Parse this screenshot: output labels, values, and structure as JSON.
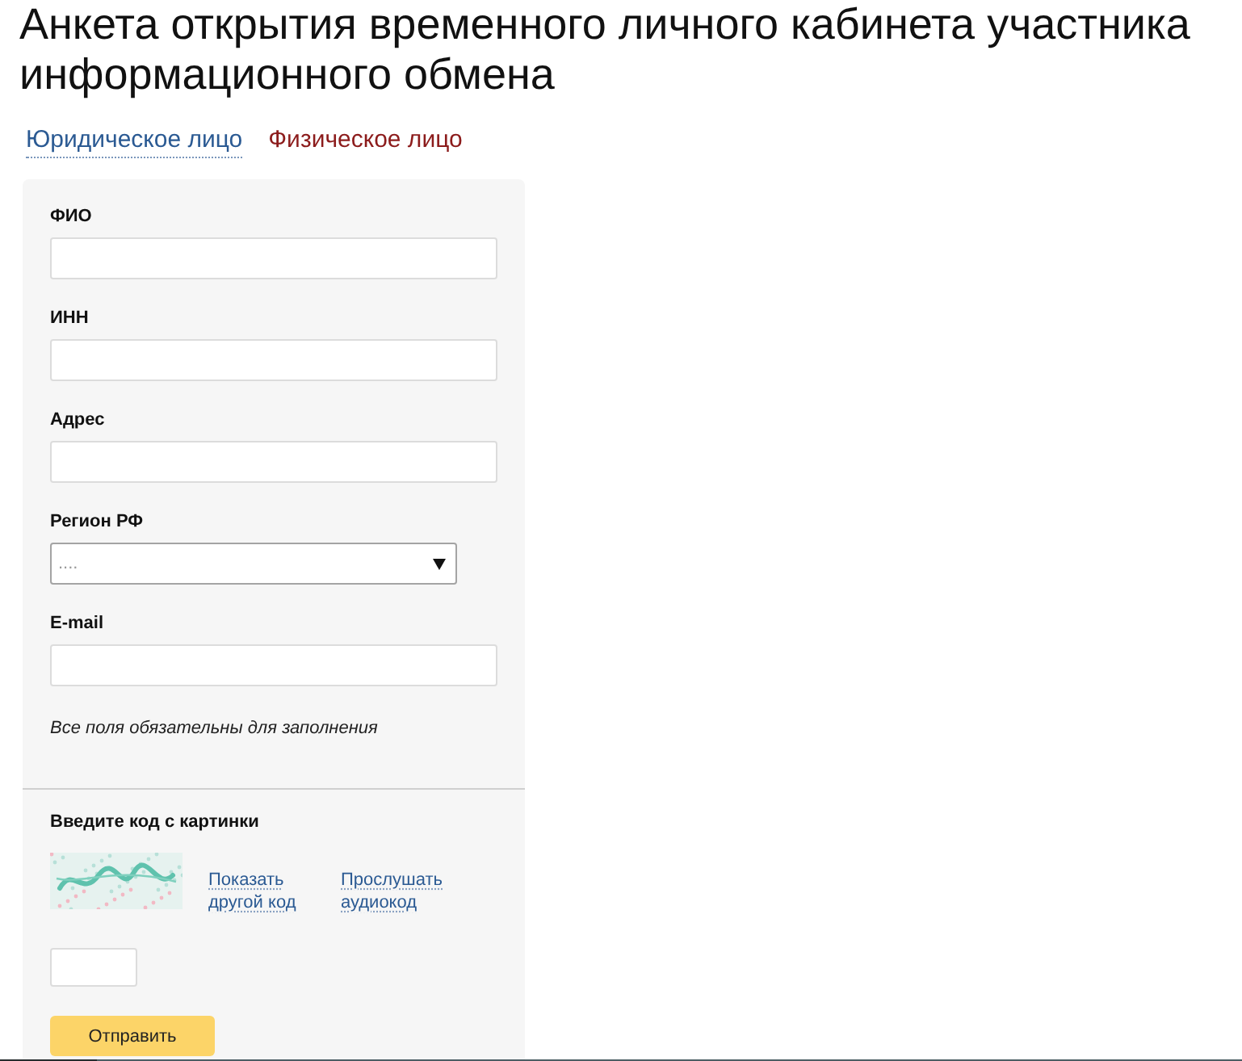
{
  "page": {
    "title": "Анкета открытия временного личного кабинета участника информационного обмена"
  },
  "tabs": [
    {
      "label": "Юридическое лицо",
      "selected": false
    },
    {
      "label": "Физическое лицо",
      "selected": true
    }
  ],
  "form": {
    "fields": [
      {
        "kind": "text",
        "label": "ФИО"
      },
      {
        "kind": "text",
        "label": "ИНН"
      },
      {
        "kind": "text",
        "label": "Адрес"
      },
      {
        "kind": "select",
        "label": "Регион РФ",
        "value": "...."
      },
      {
        "kind": "text",
        "label": "E-mail"
      }
    ],
    "note": "Все поля обязательны для заполнения"
  },
  "captcha": {
    "label": "Введите код с картинки",
    "links": [
      "Показать другой код",
      "Прослушать аудиокод"
    ]
  },
  "submit": {
    "label": "Отправить"
  }
}
